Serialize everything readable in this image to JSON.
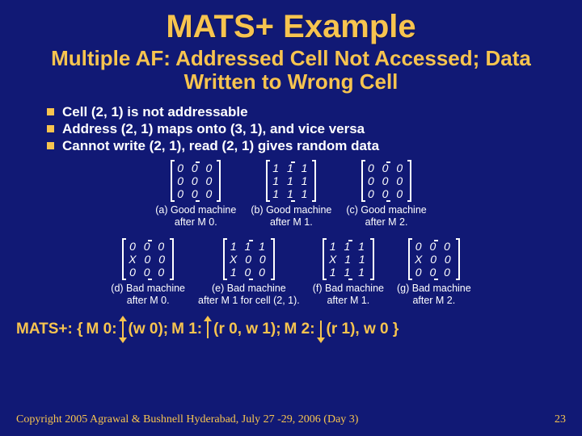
{
  "title": "MATS+ Example",
  "subtitle": "Multiple AF: Addressed Cell Not Accessed; Data Written to Wrong Cell",
  "bullets": [
    "Cell  (2, 1)  is  not addressable",
    "Address  (2, 1)  maps onto (3, 1), and vice versa",
    "Cannot  write  (2, 1), read (2, 1) gives random data"
  ],
  "good_matrices": [
    {
      "cap_label": "(a) Good machine",
      "cap_sub": "after M 0.",
      "rows": [
        "0 0 0",
        "0 0 0",
        "0 0 0"
      ]
    },
    {
      "cap_label": "(b) Good machine",
      "cap_sub": "after M 1.",
      "rows": [
        "1 1 1",
        "1 1 1",
        "1 1 1"
      ]
    },
    {
      "cap_label": "(c) Good machine",
      "cap_sub": "after M 2.",
      "rows": [
        "0 0 0",
        "0 0 0",
        "0 0 0"
      ]
    }
  ],
  "bad_matrices": [
    {
      "cap_label": "(d) Bad machine",
      "cap_sub": "after M 0.",
      "rows": [
        "0 0 0",
        "X 0 0",
        "0 0 0"
      ]
    },
    {
      "cap_label": "(e) Bad machine",
      "cap_sub": "after M 1 for cell (2, 1).",
      "rows": [
        "1 1 1",
        "X 0 0",
        "1 0 0"
      ]
    },
    {
      "cap_label": "(f) Bad machine",
      "cap_sub": "after M 1.",
      "rows": [
        "1 1 1",
        "X 1 1",
        "1 1 1"
      ]
    },
    {
      "cap_label": "(g) Bad machine",
      "cap_sub": "after M 2.",
      "rows": [
        "0 0 0",
        "X 0 0",
        "0 0 0"
      ]
    }
  ],
  "mats_prefix": "MATS+: {",
  "mats_m0": "M 0:",
  "mats_w0": "(w 0);",
  "mats_m1": "M 1:",
  "mats_r0w1": "(r 0, w 1);",
  "mats_m2": "M 2:",
  "mats_r1w0": "(r 1), w 0 }",
  "footer_left": "Copyright 2005 Agrawal & Bushnell   Hyderabad, July 27 -29, 2006 (Day 3)",
  "footer_right": "23"
}
